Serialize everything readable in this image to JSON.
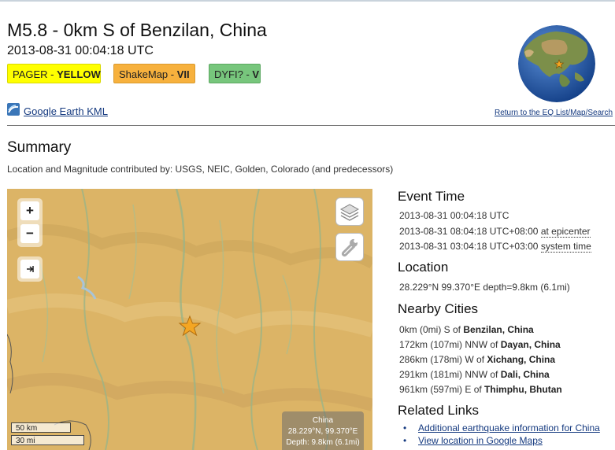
{
  "header": {
    "title": "M5.8 - 0km S of Benzilan, China",
    "datetime": "2013-08-31 00:04:18 UTC"
  },
  "badges": {
    "pager_prefix": "PAGER - ",
    "pager_value": "YELLOW",
    "shakemap_prefix": "ShakeMap - ",
    "shakemap_value": "VII",
    "dyfi_prefix": "DYFI? - ",
    "dyfi_value": "V"
  },
  "links": {
    "kml": "Google Earth KML",
    "return": "Return to the EQ List/Map/Search"
  },
  "summary": {
    "heading": "Summary",
    "contrib": "Location and Magnitude contributed by: USGS, NEIC, Golden, Colorado (and predecessors)"
  },
  "map": {
    "zoom_in": "+",
    "zoom_out": "−",
    "scale_km": "50 km",
    "scale_mi": "30 mi",
    "region": "China",
    "coords": "28.229°N, 99.370°E",
    "depth": "Depth: 9.8km (6.1mi)"
  },
  "event_time": {
    "heading": "Event Time",
    "utc": "2013-08-31 00:04:18 UTC",
    "epicenter_time": "2013-08-31 08:04:18 UTC+08:00",
    "epicenter_label": "at epicenter",
    "system_time": "2013-08-31 03:04:18 UTC+03:00",
    "system_label": "system time"
  },
  "location": {
    "heading": "Location",
    "value": "28.229°N 99.370°E depth=9.8km (6.1mi)"
  },
  "nearby": {
    "heading": "Nearby Cities",
    "cities": [
      {
        "dist": "0km (0mi) S of ",
        "city": "Benzilan, China"
      },
      {
        "dist": "172km (107mi) NNW of ",
        "city": "Dayan, China"
      },
      {
        "dist": "286km (178mi) W of ",
        "city": "Xichang, China"
      },
      {
        "dist": "291km (181mi) NNW of ",
        "city": "Dali, China"
      },
      {
        "dist": "961km (597mi) E of ",
        "city": "Thimphu, Bhutan"
      }
    ]
  },
  "related": {
    "heading": "Related Links",
    "links": [
      "Additional earthquake information for China",
      "View location in Google Maps"
    ]
  },
  "colors": {
    "pager": "#ffff00",
    "shakemap": "#f7b13d",
    "dyfi": "#77c67c",
    "link": "#14397f",
    "epicenter_star": "#f4a623"
  }
}
